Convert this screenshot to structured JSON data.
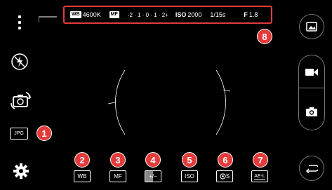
{
  "status_bar": {
    "wb_tag": "WB",
    "wb_value": "4600K",
    "mf_tag": "MF",
    "ev_scale": "-2 · 1 · 0 · 1 · 2+",
    "iso_label": "ISO",
    "iso_value": "2000",
    "shutter": "1/15s",
    "aperture_label": "F",
    "aperture_value": "1.8"
  },
  "left_bar": {
    "jpg_label": "JPG"
  },
  "bottom_controls": {
    "wb_label": "WB",
    "mf_label": "MF",
    "ev_label": "+/−",
    "iso_label": "ISO",
    "shutter_label": "S",
    "ael_label": "AE-L"
  },
  "badges": [
    "1",
    "2",
    "3",
    "4",
    "5",
    "6",
    "7",
    "8"
  ],
  "colors": {
    "badge": "#e33b3b",
    "background": "#000000",
    "foreground": "#ffffff",
    "button_border": "#777777"
  },
  "icons": [
    "menu-icon",
    "flash-off-icon",
    "camera-swap-icon",
    "gear-icon",
    "gallery-icon",
    "video-icon",
    "camera-icon",
    "back-icon"
  ]
}
